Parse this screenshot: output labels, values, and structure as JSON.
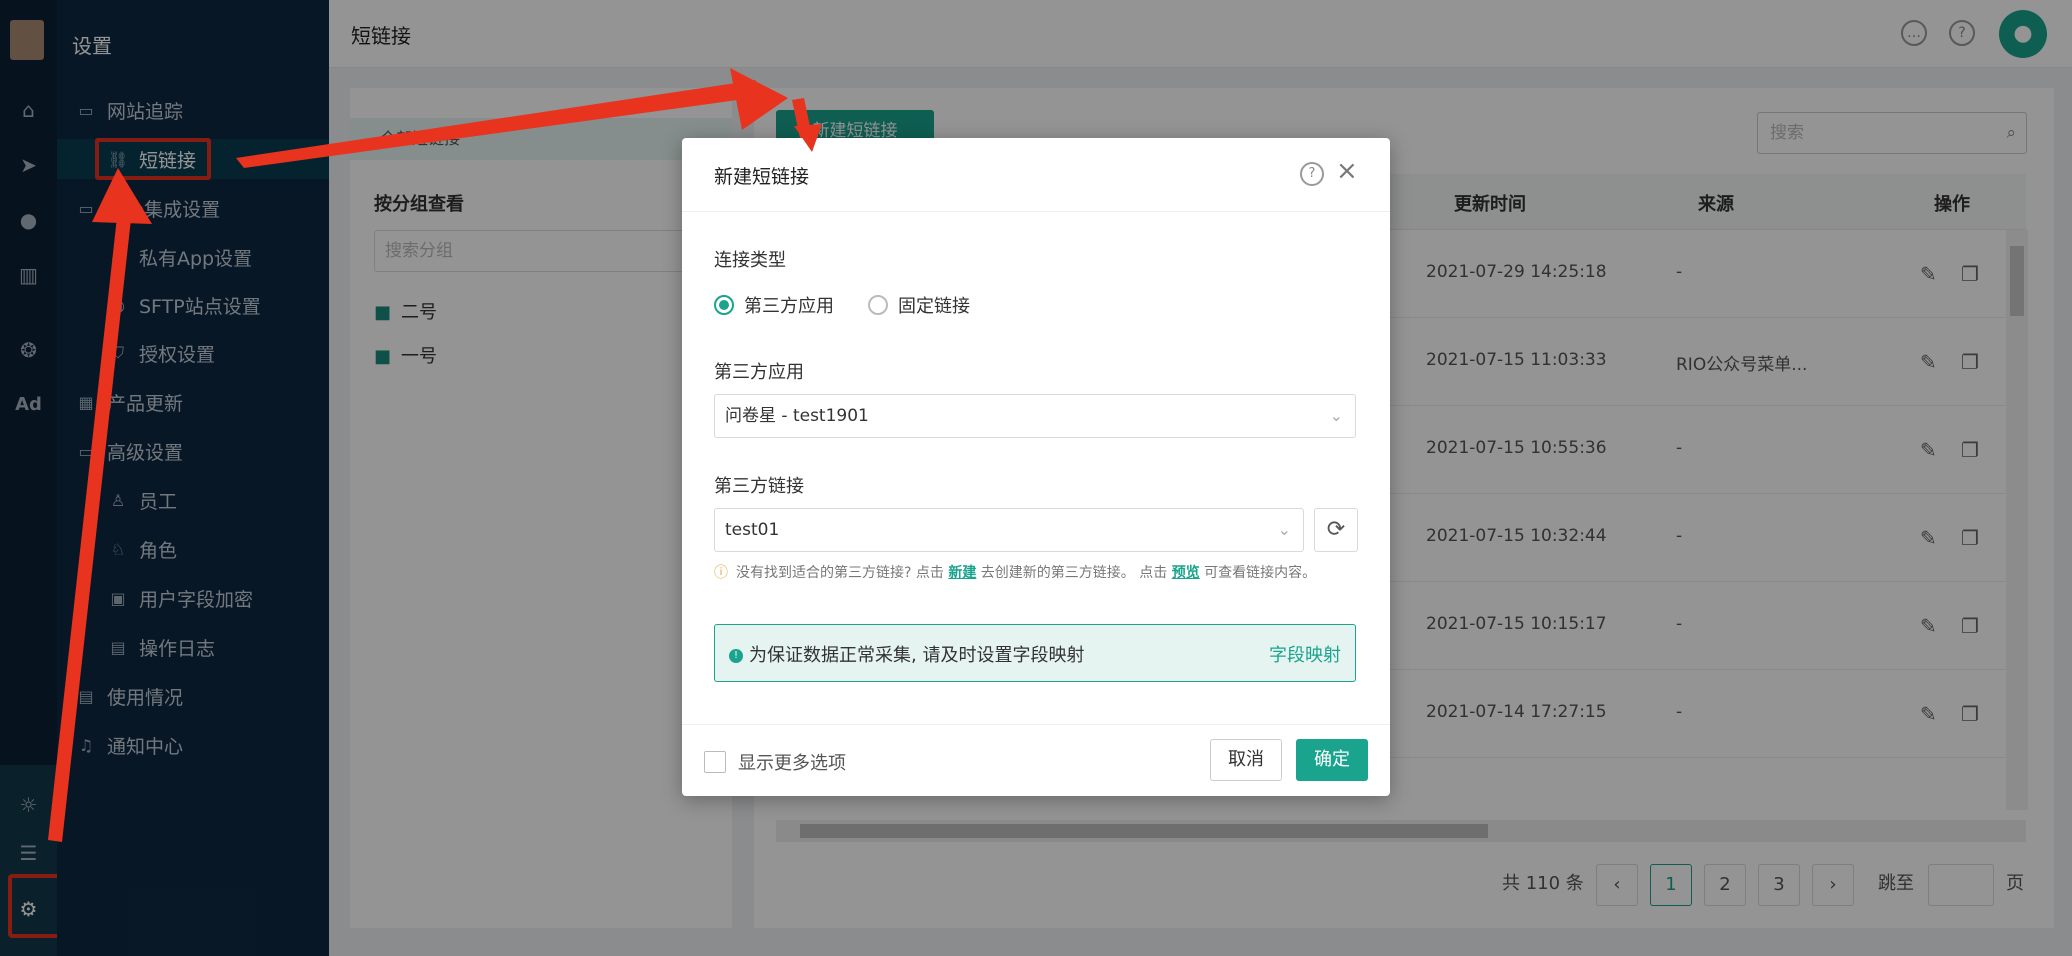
{
  "nav": {
    "title": "设置",
    "items": [
      {
        "label": "网站追踪",
        "icon": "folder-icon"
      },
      {
        "label": "短链接",
        "icon": "link-icon"
      },
      {
        "label": "App集成设置",
        "icon": "folder-icon"
      },
      {
        "label": "私有App设置",
        "icon": "app-icon"
      },
      {
        "label": "SFTP站点设置",
        "icon": "globe-icon"
      },
      {
        "label": "授权设置",
        "icon": "shield-icon"
      },
      {
        "label": "产品更新",
        "icon": "grid-icon"
      },
      {
        "label": "高级设置",
        "icon": "folder-icon"
      },
      {
        "label": "员工",
        "icon": "user-icon"
      },
      {
        "label": "角色",
        "icon": "role-icon"
      },
      {
        "label": "用户字段加密",
        "icon": "lock-icon"
      },
      {
        "label": "操作日志",
        "icon": "log-icon"
      },
      {
        "label": "使用情况",
        "icon": "usage-icon"
      },
      {
        "label": "通知中心",
        "icon": "bell-icon"
      }
    ]
  },
  "rail": {
    "ad_label": "Ad"
  },
  "header": {
    "title": "短链接"
  },
  "groups": {
    "all_label": "全部短链接",
    "title": "按分组查看",
    "search_placeholder": "搜索分组",
    "items": [
      "二号",
      "一号"
    ]
  },
  "main": {
    "new_button": "新建短链接",
    "search_placeholder": "搜索",
    "columns": {
      "updated": "更新时间",
      "source": "来源",
      "actions": "操作"
    },
    "rows": [
      {
        "time": "2021-07-29 14:25:18",
        "source": "-"
      },
      {
        "time": "2021-07-15 11:03:33",
        "source": "RIO公众号菜单..."
      },
      {
        "time": "2021-07-15 10:55:36",
        "source": "-"
      },
      {
        "time": "2021-07-15 10:32:44",
        "source": "-"
      },
      {
        "time": "2021-07-15 10:15:17",
        "source": "-"
      },
      {
        "time": "2021-07-14 17:27:15",
        "source": "-"
      }
    ],
    "pagination": {
      "total": "共 110 条",
      "pages": [
        "1",
        "2",
        "3"
      ],
      "jump_label": "跳至",
      "page_unit": "页"
    }
  },
  "modal": {
    "title": "新建短链接",
    "type_label": "连接类型",
    "type_options": [
      "第三方应用",
      "固定链接"
    ],
    "app_label": "第三方应用",
    "app_value": "问卷星 - test1901",
    "link_label": "第三方链接",
    "link_value": "test01",
    "tip_text": "没有找到适合的第三方链接? 点击",
    "tip_new": "新建",
    "tip_mid": "去创建新的第三方链接。 点击",
    "tip_preview": "预览",
    "tip_end": "可查看链接内容。",
    "notice_text": "为保证数据正常采集, 请及时设置字段映射",
    "notice_link": "字段映射",
    "more_options": "显示更多选项",
    "cancel": "取消",
    "confirm": "确定"
  },
  "colors": {
    "accent": "#1aa38d",
    "annotation": "#e8331f",
    "sidebar": "#0f2942"
  }
}
